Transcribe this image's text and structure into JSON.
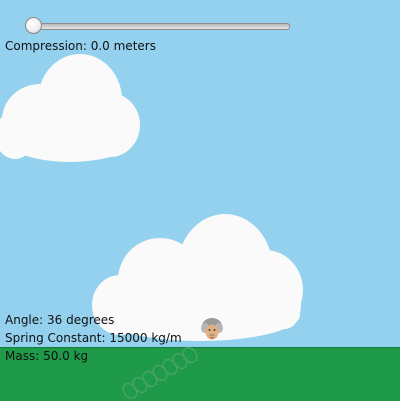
{
  "slider": {
    "value_fraction": 0.0
  },
  "readouts": {
    "compression": "Compression: 0.0 meters",
    "angle": "Angle: 36 degrees",
    "spring_constant": "Spring Constant: 15000 kg/m",
    "mass": "Mass: 50.0 kg"
  },
  "colors": {
    "sky": "#93d1ee",
    "ground": "#1e9a48",
    "cloud": "#fafafa"
  },
  "icons": {
    "character": "einstein-face-icon",
    "spring": "spring-coil-icon"
  }
}
